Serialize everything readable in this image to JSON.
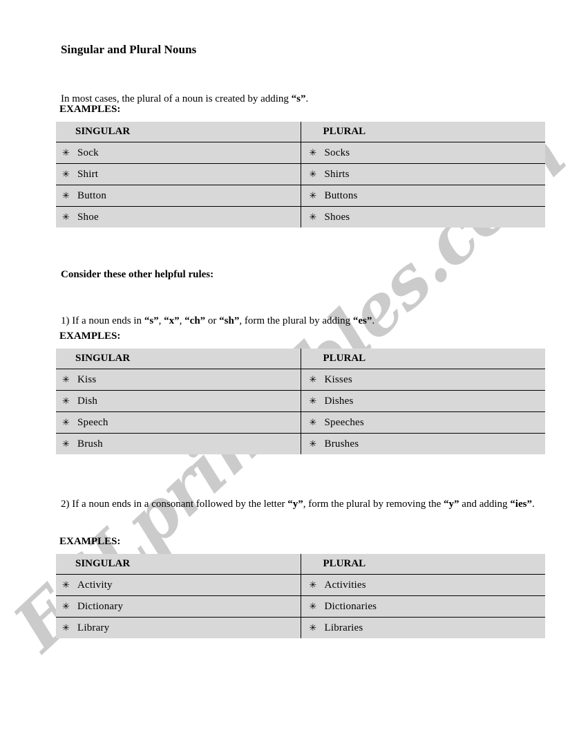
{
  "document": {
    "title": "Singular and Plural Nouns",
    "intro": {
      "before": "In most cases, the plural of a noun is created by adding ",
      "emphasis": "“s”",
      "after": "."
    },
    "examples_label": "EXAMPLES:",
    "consider_heading": "Consider these other helpful rules:",
    "rules": [
      {
        "number": "1)",
        "text": " If a noun ends in “s”, “x”, “ch” or “sh”, form the plural by adding “es”.",
        "parts": {
          "p1": "1) If a noun ends in ",
          "b1": "“s”",
          "p2": ", ",
          "b2": "“x”",
          "p3": ", ",
          "b3": "“ch”",
          "p4": " or ",
          "b4": "“sh”",
          "p5": ", form the plural by adding ",
          "b5": "“es”",
          "p6": "."
        }
      },
      {
        "number": "2)",
        "text": "2) If a noun ends in a consonant followed by the letter “y”, form the plural by removing the “y” and adding “ies”.",
        "parts": {
          "p1": "2) If a noun ends in a consonant followed by the letter ",
          "b1": "“y”",
          "p2": ", form the plural by removing the ",
          "b2": "“y”",
          "p3": " and adding ",
          "b3": "“ies”",
          "p4": "."
        }
      }
    ],
    "tables": [
      {
        "id": "table-1",
        "headers": {
          "singular": "SINGULAR",
          "plural": "PLURAL"
        },
        "rows": [
          {
            "singular": "Sock",
            "plural": "Socks"
          },
          {
            "singular": "Shirt",
            "plural": "Shirts"
          },
          {
            "singular": "Button",
            "plural": "Buttons"
          },
          {
            "singular": "Shoe",
            "plural": "Shoes"
          }
        ]
      },
      {
        "id": "table-2",
        "headers": {
          "singular": "SINGULAR",
          "plural": "PLURAL"
        },
        "rows": [
          {
            "singular": "Kiss",
            "plural": "Kisses"
          },
          {
            "singular": "Dish",
            "plural": "Dishes"
          },
          {
            "singular": "Speech",
            "plural": "Speeches"
          },
          {
            "singular": "Brush",
            "plural": "Brushes"
          }
        ]
      },
      {
        "id": "table-3",
        "headers": {
          "singular": "SINGULAR",
          "plural": "PLURAL"
        },
        "rows": [
          {
            "singular": "Activity",
            "plural": "Activities"
          },
          {
            "singular": "Dictionary",
            "plural": "Dictionaries"
          },
          {
            "singular": "Library",
            "plural": "Libraries"
          }
        ]
      }
    ],
    "bullet_glyph": "✳",
    "watermark": {
      "text": "ESLprintables.com",
      "color": "#c9c9c9"
    },
    "colors": {
      "table_background": "#d8d8d8",
      "border": "#000000",
      "page_background": "#ffffff",
      "text": "#000000"
    }
  }
}
